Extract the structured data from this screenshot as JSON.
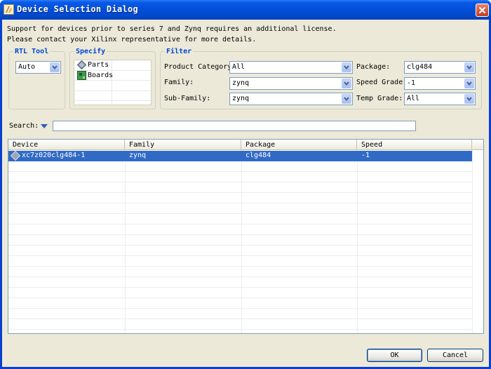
{
  "window": {
    "title": "Device Selection Dialog"
  },
  "message": {
    "line1": "Support for devices prior to series 7 and Zynq requires an additional license.",
    "line2": "Please contact your Xilinx representative for more details."
  },
  "rtl_tool": {
    "legend": "RTL Tool",
    "value": "Auto"
  },
  "specify": {
    "legend": "Specify",
    "items": [
      {
        "label": "Parts",
        "icon": "chip-icon"
      },
      {
        "label": "Boards",
        "icon": "board-icon"
      }
    ]
  },
  "filter": {
    "legend": "Filter",
    "product_category": {
      "label": "Product Category:",
      "value": "All"
    },
    "family": {
      "label": "Family:",
      "value": "zynq"
    },
    "sub_family": {
      "label": "Sub-Family:",
      "value": "zynq"
    },
    "package": {
      "label": "Package:",
      "value": "clg484"
    },
    "speed_grade": {
      "label": "Speed Grade:",
      "value": "-1"
    },
    "temp_grade": {
      "label": "Temp Grade:",
      "value": "All"
    }
  },
  "search": {
    "label": "Search:",
    "value": ""
  },
  "table": {
    "columns": [
      "Device",
      "Family",
      "Package",
      "Speed"
    ],
    "rows": [
      {
        "device": "xc7z020clg484-1",
        "family": "zynq",
        "package": "clg484",
        "speed": "-1",
        "selected": true
      }
    ]
  },
  "buttons": {
    "ok": "OK",
    "cancel": "Cancel"
  },
  "colors": {
    "title_bar": "#0250d8",
    "selection": "#316ac5",
    "legend_text": "#0046d5",
    "dialog_bg": "#ece9d8"
  }
}
